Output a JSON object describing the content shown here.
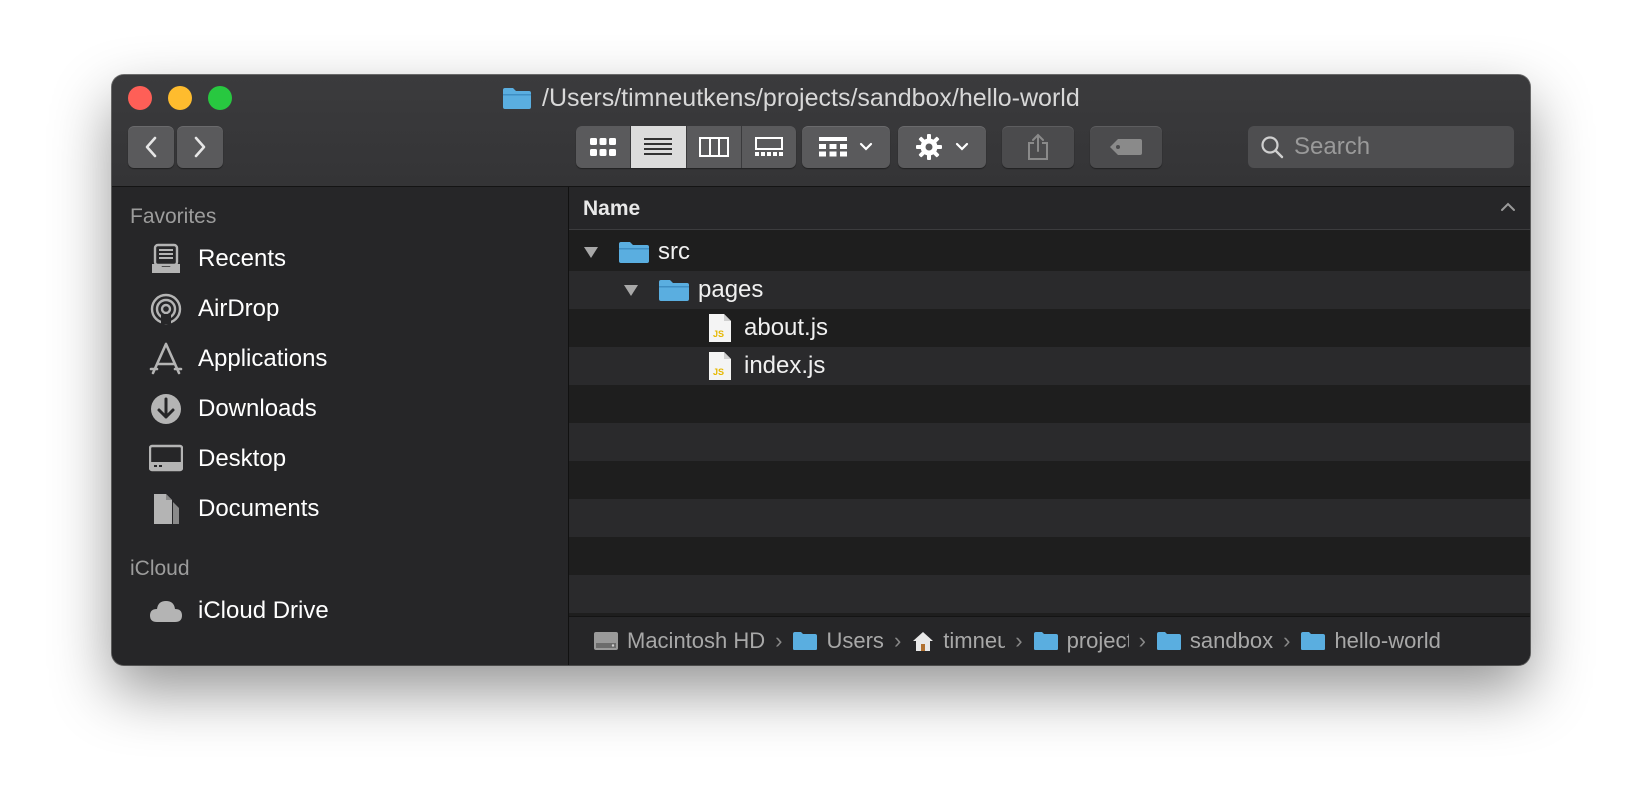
{
  "window": {
    "title": "/Users/timneutkens/projects/sandbox/hello-world"
  },
  "toolbar": {
    "back_icon": "chevron-left-icon",
    "forward_icon": "chevron-right-icon",
    "view_modes": [
      "icon-view",
      "list-view",
      "column-view",
      "gallery-view"
    ],
    "active_view": "list-view",
    "search_placeholder": "Search"
  },
  "sidebar": {
    "favorites_label": "Favorites",
    "favorites": [
      {
        "label": "Recents",
        "icon": "recents-icon"
      },
      {
        "label": "AirDrop",
        "icon": "airdrop-icon"
      },
      {
        "label": "Applications",
        "icon": "applications-icon"
      },
      {
        "label": "Downloads",
        "icon": "downloads-icon"
      },
      {
        "label": "Desktop",
        "icon": "desktop-icon"
      },
      {
        "label": "Documents",
        "icon": "documents-icon"
      }
    ],
    "icloud_label": "iCloud",
    "icloud": [
      {
        "label": "iCloud Drive",
        "icon": "cloud-icon"
      }
    ]
  },
  "list": {
    "column_header": "Name",
    "rows": [
      {
        "name": "src",
        "type": "folder",
        "expanded": true,
        "depth": 0
      },
      {
        "name": "pages",
        "type": "folder",
        "expanded": true,
        "depth": 1
      },
      {
        "name": "about.js",
        "type": "js-file",
        "depth": 2
      },
      {
        "name": "index.js",
        "type": "js-file",
        "depth": 2
      }
    ]
  },
  "pathbar": {
    "items": [
      {
        "label": "Macintosh HD",
        "icon": "hard-drive-icon"
      },
      {
        "label": "Users",
        "icon": "folder-icon"
      },
      {
        "label": "timneutkens",
        "icon": "home-icon"
      },
      {
        "label": "projects",
        "icon": "folder-icon"
      },
      {
        "label": "sandbox",
        "icon": "folder-icon"
      },
      {
        "label": "hello-world",
        "icon": "folder-icon"
      }
    ]
  },
  "colors": {
    "folder": "#5aaee0",
    "close": "#fe5f57",
    "minimize": "#febc2e",
    "maximize": "#28c840"
  }
}
